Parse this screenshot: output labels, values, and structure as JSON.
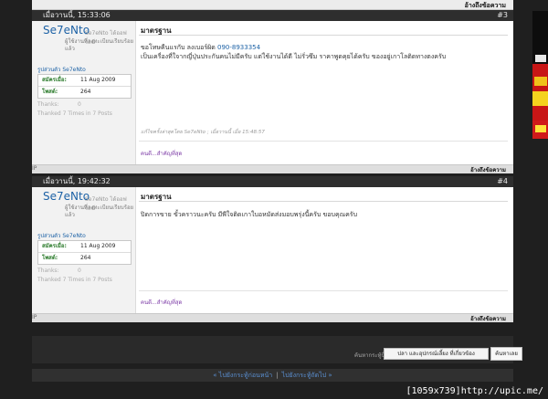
{
  "top_strip": {
    "quote_label": "อ้างถึงข้อความ"
  },
  "posts": [
    {
      "date": "เมื่อวานนี้, 15:33:06",
      "number": "#3",
      "user": {
        "name": "Se7eNto",
        "status": "Se7eNto ได้ออฟไลน์",
        "title": "ผู้ใช้งานที่ลงทะเบียนเรียบร้อยแล้ว",
        "profile_link": "รูปส่วนตัว Se7eNto",
        "joined_label": "สมัครเมื่อ:",
        "joined_value": "11 Aug 2009",
        "posts_label": "โพสต์:",
        "posts_value": "264",
        "thanks_label": "Thanks:",
        "thanks_value": "0",
        "thanked": "Thanked 7 Times in 7 Posts"
      },
      "title": "มาตรฐาน",
      "message_line1_text": "ขอโทษคืนแรกับ ลงเบอร์ผิด ",
      "message_line1_phone": "090-8933354",
      "message_line2": "เป็นเครื่องที่ใจากญี่ปุ่นประกันคนไม่มีครับ แต่ใช้งานได้ดี ไม่รั่วซึม ราคาพูดคุยได้ครับ ของอยู่เกาโลติดทางตงครับ",
      "edit_note": "แก้ไขครั้งล่าสุดโดย Se7eNto ; เมื่อวานนี้ เมื่อ 15:48:57",
      "signature": "คนดี...สำคัญที่สุด",
      "footer_ip": "IP",
      "footer_quote": "อ้างถึงข้อความ"
    },
    {
      "date": "เมื่อวานนี้, 19:42:32",
      "number": "#4",
      "user": {
        "name": "Se7eNto",
        "status": "Se7eNto ได้ออฟไลน์",
        "title": "ผู้ใช้งานที่ลงทะเบียนเรียบร้อยแล้ว",
        "profile_link": "รูปส่วนตัว Se7eNto",
        "joined_label": "สมัครเมื่อ:",
        "joined_value": "11 Aug 2009",
        "posts_label": "โพสต์:",
        "posts_value": "264",
        "thanks_label": "Thanks:",
        "thanks_value": "0",
        "thanked": "Thanked 7 Times in 7 Posts"
      },
      "title": "มาตรฐาน",
      "message_line1": "ปิดการขาย ขั้วคราวนะครับ มีพีใจติดเกาใบอหมัดส่งมอบพรุ่งนี้ครับ ขอบคุณครับ",
      "signature": "คนดี...สำคัญที่สุด",
      "footer_ip": "IP",
      "footer_quote": "อ้างถึงข้อความ"
    }
  ],
  "search": {
    "label": "ค้นหากระทู้นี้",
    "select_value": "ปลา และอุปกรณ์เลี้ยง ที่เกี่ยวข้อง",
    "button": "ค้นหาเลย"
  },
  "thread_nav": {
    "prev": "« ไปยังกระทู้ก่อนหน้า",
    "separator": "|",
    "next": "ไปยังกระทู้ถัดไป »"
  },
  "watermark": "[1059x739]http://upic.me/"
}
